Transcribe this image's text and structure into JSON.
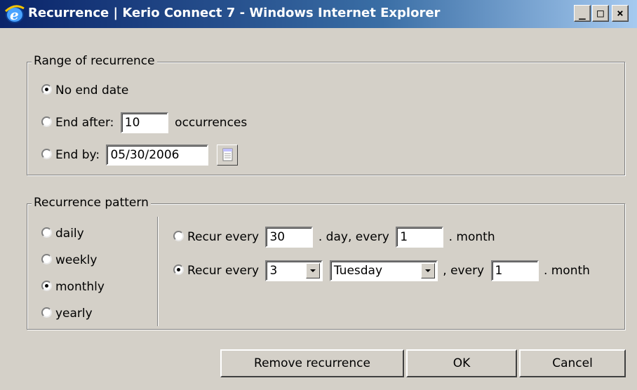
{
  "window": {
    "title": "Recurrence | Kerio Connect 7 - Windows Internet Explorer",
    "minimize_label": "_",
    "maximize_label": "□",
    "close_label": "×"
  },
  "range": {
    "legend": "Range of recurrence",
    "no_end_date": "No end date",
    "end_after_label": "End after:",
    "end_after_value": "10",
    "occurrences_label": "occurrences",
    "end_by_label": "End by:",
    "end_by_value": "05/30/2006",
    "selected": "no_end_date"
  },
  "pattern": {
    "legend": "Recurrence pattern",
    "frequencies": [
      "daily",
      "weekly",
      "monthly",
      "yearly"
    ],
    "selected_frequency": "monthly",
    "option1": {
      "recur_every_label": "Recur every",
      "day_value": "30",
      "day_every_label": ". day, every",
      "month_value": "1",
      "month_label": ". month"
    },
    "option2": {
      "recur_every_label": "Recur every",
      "ordinal_value": "3",
      "weekday_value": "Tuesday",
      "every_label": ", every",
      "month_value": "1",
      "month_label": ". month"
    },
    "selected_option": "option2"
  },
  "buttons": {
    "remove": "Remove recurrence",
    "ok": "OK",
    "cancel": "Cancel"
  }
}
